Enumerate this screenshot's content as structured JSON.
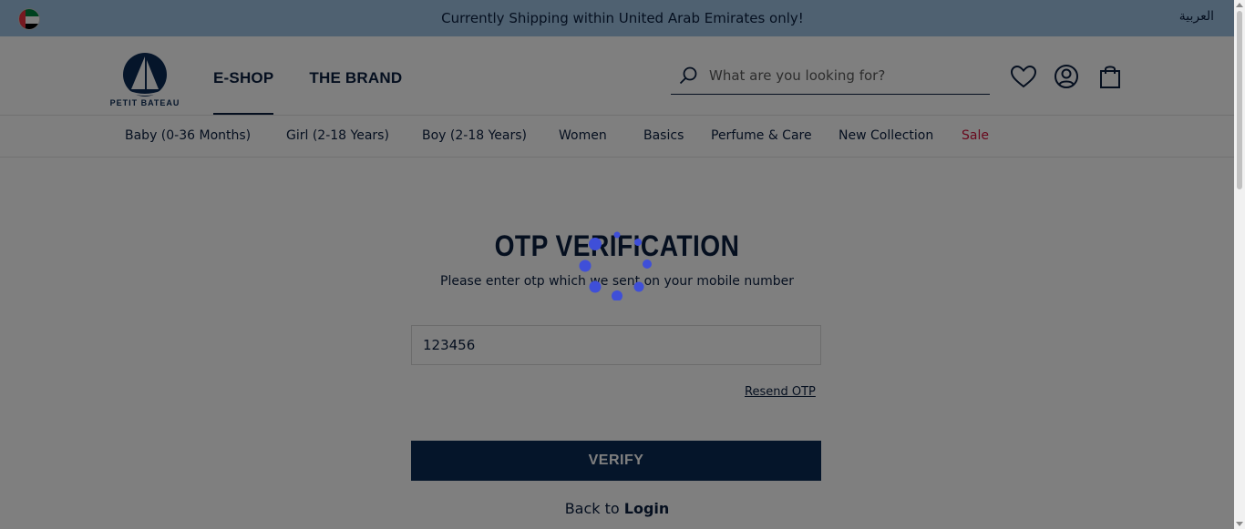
{
  "topbar": {
    "message": "Currently Shipping within United Arab Emirates only!",
    "language_link": "العربية",
    "flag_icon": "uae-flag-icon"
  },
  "header": {
    "logo_text": "PETIT BATEAU",
    "nav": [
      {
        "label": "E-SHOP",
        "active": true
      },
      {
        "label": "THE BRAND",
        "active": false
      }
    ],
    "search": {
      "placeholder": "What are you looking for?",
      "icon": "search-icon"
    },
    "icons": [
      "heart-icon",
      "account-icon",
      "bag-icon"
    ]
  },
  "categories": [
    {
      "label": "Baby (0-36 Months)"
    },
    {
      "label": "Girl (2-18 Years)"
    },
    {
      "label": "Boy (2-18 Years)"
    },
    {
      "label": "Women"
    },
    {
      "label": "Basics"
    },
    {
      "label": "Perfume & Care"
    },
    {
      "label": "New Collection"
    },
    {
      "label": "Sale",
      "color": "#d0123b"
    }
  ],
  "otp": {
    "title": "OTP VERIFICATION",
    "subtitle": "Please enter otp which we sent on your mobile number",
    "value": "123456",
    "resend_label": "Resend OTP",
    "verify_label": "VERIFY",
    "back_text": "Back to",
    "back_link": "Login"
  },
  "colors": {
    "topbar_bg": "#9ec3e3",
    "navy": "#0b1f3f",
    "button_bg": "#0b2a55",
    "sale": "#d0123b",
    "spinner": "#3f4fd8"
  }
}
